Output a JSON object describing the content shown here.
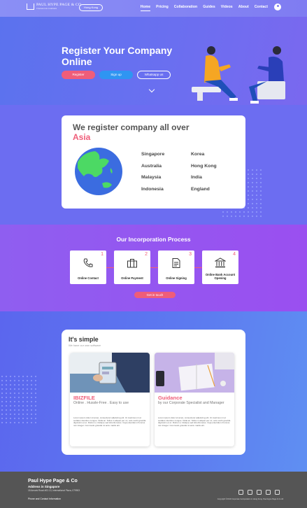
{
  "header": {
    "brand_line1": "PAUL HYPE PAGE & CO",
    "brand_line2": "Chartered Accountants",
    "region_button": "Hong Kong",
    "nav": [
      "Home",
      "Pricing",
      "Collaboration",
      "Guides",
      "Videos",
      "About",
      "Contact"
    ],
    "active_nav": "Home",
    "user_icon": "user-circle-icon"
  },
  "hero": {
    "title": "Register Your Company Online",
    "buttons": [
      "Register",
      "Sign up",
      "Whatsapp us"
    ],
    "scroll_icon": "chevron-down-icon"
  },
  "asia": {
    "title": "We register company all over",
    "accent": "Asia",
    "countries": [
      "Singapore",
      "Korea",
      "Australia",
      "Hong Kong",
      "Malaysia",
      "India",
      "Indonesia",
      "England"
    ]
  },
  "process": {
    "title": "Our Incorporation Process",
    "steps": [
      {
        "num": "1",
        "label": "Online Contact",
        "icon": "phone-icon"
      },
      {
        "num": "2",
        "label": "Online Payment",
        "icon": "briefcase-icon"
      },
      {
        "num": "3",
        "label": "Online Signing",
        "icon": "document-icon"
      },
      {
        "num": "4",
        "label": "Online Bank Account Opening",
        "icon": "bank-icon"
      }
    ],
    "cta": "Get in touch"
  },
  "simple": {
    "title": "It's simple",
    "subtitle": "We have our own software",
    "cards": [
      {
        "title": "IBIZFILE",
        "tagline": "Online . Hussle-Free . Easy to use",
        "body": "Lorem ipsum dolor sit amet, consectetur adipiscing elit. Ut maximus mi et sodales interdum congue. Nulla ac. Tellus in aliquet per mi, vels morbi gravida dignissim et et. Rutrum e tristique sed lobortis lacus. Cuja entertdum rhoncus non integer. Commodo gravida mi accu mattis elit."
      },
      {
        "title": "Guidance",
        "tagline": "by our Corporate Specialist and Manager",
        "body": "Lorem ipsum dolor sit amet, consectetur adipiscing elit. Ut maximus mi et sodales interdum congue. Nulla ac. Tellus in aliquet per mi, vels morbi gravida dignissim et et. Rutrum e tristique sed lobortis lacus. Cuja entertdum rhoncus non integer. Commodo gravida mi accu mattis elit."
      }
    ]
  },
  "footer": {
    "name": "Paul Hype Page & Co",
    "address_title": "Address in Singapore",
    "street": "18 Amoek Road #02-13, International Plaza, 079903",
    "contact": "Phone and Contact Information",
    "copyright": "Copyright ©2019 Corporate Incorporation in Hong Kong. Paul Hype Page & Co All",
    "social_icons": [
      "facebook-icon",
      "linkedin-icon",
      "instagram-icon",
      "youtube-icon",
      "mail-icon"
    ]
  },
  "colors": {
    "accent": "#ef5d79",
    "blue_button": "#2f95f2",
    "footer": "#555555"
  }
}
